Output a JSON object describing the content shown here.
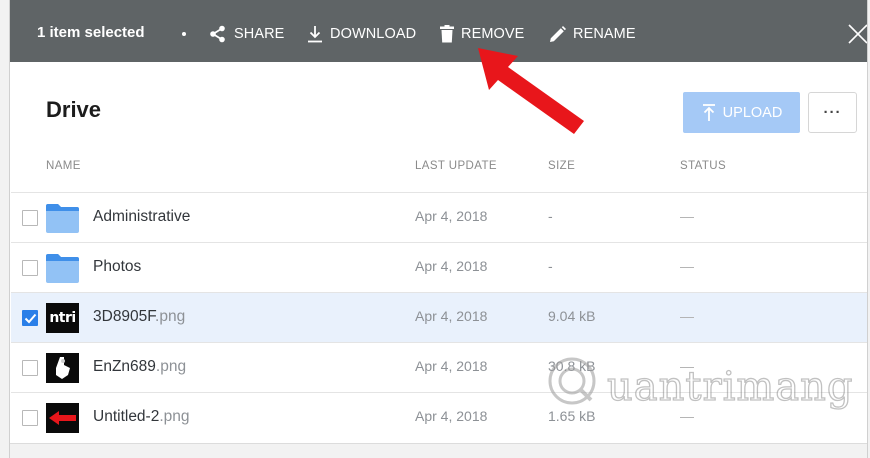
{
  "selection_bar": {
    "count_label": "1 item selected",
    "actions": {
      "share": "SHARE",
      "download": "DOWNLOAD",
      "remove": "REMOVE",
      "rename": "RENAME"
    }
  },
  "header": {
    "title": "Drive",
    "upload_label": "UPLOAD",
    "more_label": "···"
  },
  "table": {
    "columns": {
      "name": "NAME",
      "last_update": "LAST UPDATE",
      "size": "SIZE",
      "status": "STATUS"
    },
    "rows": [
      {
        "name": "Administrative",
        "ext": "",
        "icon": "folder-icon",
        "date": "Apr 4, 2018",
        "size": "-",
        "status": "—",
        "checked": false
      },
      {
        "name": "Photos",
        "ext": "",
        "icon": "folder-icon",
        "date": "Apr 4, 2018",
        "size": "-",
        "status": "—",
        "checked": false
      },
      {
        "name": "3D8905F",
        "ext": ".png",
        "icon": "image-thumbnail-icon",
        "thumb_text": "ntri",
        "date": "Apr 4, 2018",
        "size": "9.04 kB",
        "status": "—",
        "checked": true
      },
      {
        "name": "EnZn689",
        "ext": ".png",
        "icon": "image-thumbnail-icon",
        "date": "Apr 4, 2018",
        "size": "30.8 kB",
        "status": "—",
        "checked": false
      },
      {
        "name": "Untitled-2",
        "ext": ".png",
        "icon": "image-thumbnail-icon",
        "date": "Apr 4, 2018",
        "size": "1.65 kB",
        "status": "—",
        "checked": false
      }
    ]
  },
  "watermark": {
    "text": "uantrimang"
  },
  "colors": {
    "toolbar": "#5f6466",
    "accent": "#2a7fe8",
    "upload_disabled": "#a5c9f6",
    "folder": "#4a9af0",
    "arrow": "#e8161b"
  }
}
